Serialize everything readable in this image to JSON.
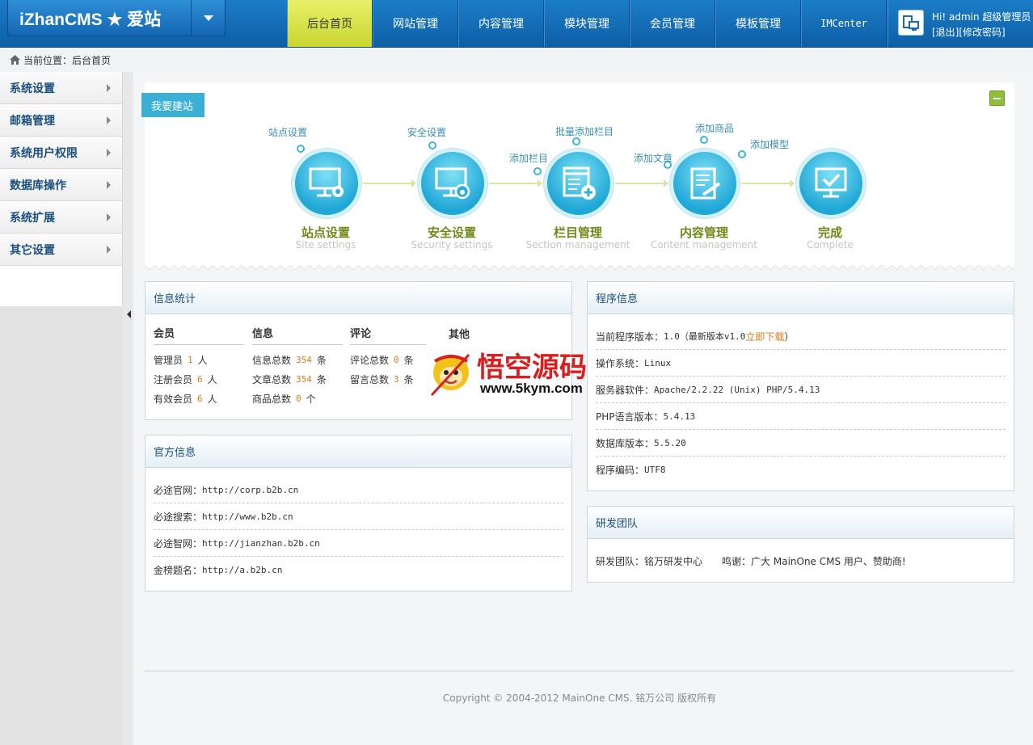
{
  "header": {
    "logo_text": "iZhanCMS ★ 爱站",
    "nav": [
      {
        "label": "后台首页",
        "active": true
      },
      {
        "label": "网站管理"
      },
      {
        "label": "内容管理"
      },
      {
        "label": "模块管理"
      },
      {
        "label": "会员管理"
      },
      {
        "label": "模板管理"
      },
      {
        "label": "IMCenter"
      }
    ],
    "user_greeting": "Hi! admin 超级管理员",
    "logout": "[退出]",
    "change_password": "[修改密码]"
  },
  "breadcrumb": {
    "prefix": "当前位置：",
    "current": "后台首页"
  },
  "sidebar": {
    "items": [
      {
        "label": "系统设置"
      },
      {
        "label": "邮箱管理"
      },
      {
        "label": "系统用户权限"
      },
      {
        "label": "数据库操作"
      },
      {
        "label": "系统扩展"
      },
      {
        "label": "其它设置"
      }
    ]
  },
  "wizard": {
    "tag": "我要建站",
    "steps": [
      {
        "title": "站点设置",
        "subtitle": "Site settings",
        "icon": "monitor-gear-icon"
      },
      {
        "title": "安全设置",
        "subtitle": "Security settings",
        "icon": "monitor-lock-icon"
      },
      {
        "title": "栏目管理",
        "subtitle": "Section management",
        "icon": "window-add-icon"
      },
      {
        "title": "内容管理",
        "subtitle": "Content management",
        "icon": "document-pen-icon"
      },
      {
        "title": "完成",
        "subtitle": "Complete",
        "icon": "monitor-check-icon"
      }
    ],
    "links": {
      "site_settings": "站点设置",
      "security_settings": "安全设置",
      "add_column": "添加栏目",
      "batch_add_column": "批量添加栏目",
      "add_article": "添加文章",
      "add_product": "添加商品",
      "add_model": "添加模型"
    }
  },
  "stats": {
    "title": "信息统计",
    "columns": [
      {
        "header": "会员",
        "rows": [
          {
            "label": "管理员",
            "value": "1",
            "unit": "人"
          },
          {
            "label": "注册会员",
            "value": "6",
            "unit": "人"
          },
          {
            "label": "有效会员",
            "value": "6",
            "unit": "人"
          }
        ]
      },
      {
        "header": "信息",
        "rows": [
          {
            "label": "信息总数",
            "value": "354",
            "unit": "条"
          },
          {
            "label": "文章总数",
            "value": "354",
            "unit": "条"
          },
          {
            "label": "商品总数",
            "value": "0",
            "unit": "个"
          }
        ]
      },
      {
        "header": "评论",
        "rows": [
          {
            "label": "评论总数",
            "value": "0",
            "unit": "条"
          },
          {
            "label": "留言总数",
            "value": "3",
            "unit": "条"
          }
        ]
      },
      {
        "header": "其他",
        "rows": []
      }
    ]
  },
  "official": {
    "title": "官方信息",
    "rows": [
      {
        "label": "必途官网：",
        "value": "http://corp.b2b.cn"
      },
      {
        "label": "必途搜索：",
        "value": "http://www.b2b.cn"
      },
      {
        "label": "必途智网：",
        "value": "http://jianzhan.b2b.cn"
      },
      {
        "label": "金榜题名：",
        "value": "http://a.b2b.cn"
      }
    ]
  },
  "program": {
    "title": "程序信息",
    "version_label": "当前程序版本：",
    "version_value": "1.0（最新版本v1.0",
    "download": "立即下载",
    "version_close": "）",
    "rows": [
      {
        "label": "操作系统：",
        "value": "Linux"
      },
      {
        "label": "服务器软件：",
        "value": "Apache/2.2.22 (Unix) PHP/5.4.13"
      },
      {
        "label": "PHP语言版本：",
        "value": "5.4.13"
      },
      {
        "label": "数据库版本：",
        "value": "5.5.20"
      },
      {
        "label": "程序编码：",
        "value": "UTF8"
      }
    ]
  },
  "team": {
    "title": "研发团队",
    "team_label": "研发团队：",
    "team_value": "铭万研发中心",
    "thanks_label": "鸣谢：",
    "thanks_value": "广大 MainOne CMS 用户、赞助商!"
  },
  "footer": {
    "text": "Copyright © 2004-2012 MainOne CMS. 铭万公司 版权所有"
  },
  "watermark": {
    "text": "悟空源码",
    "url": "www.5kym.com"
  }
}
